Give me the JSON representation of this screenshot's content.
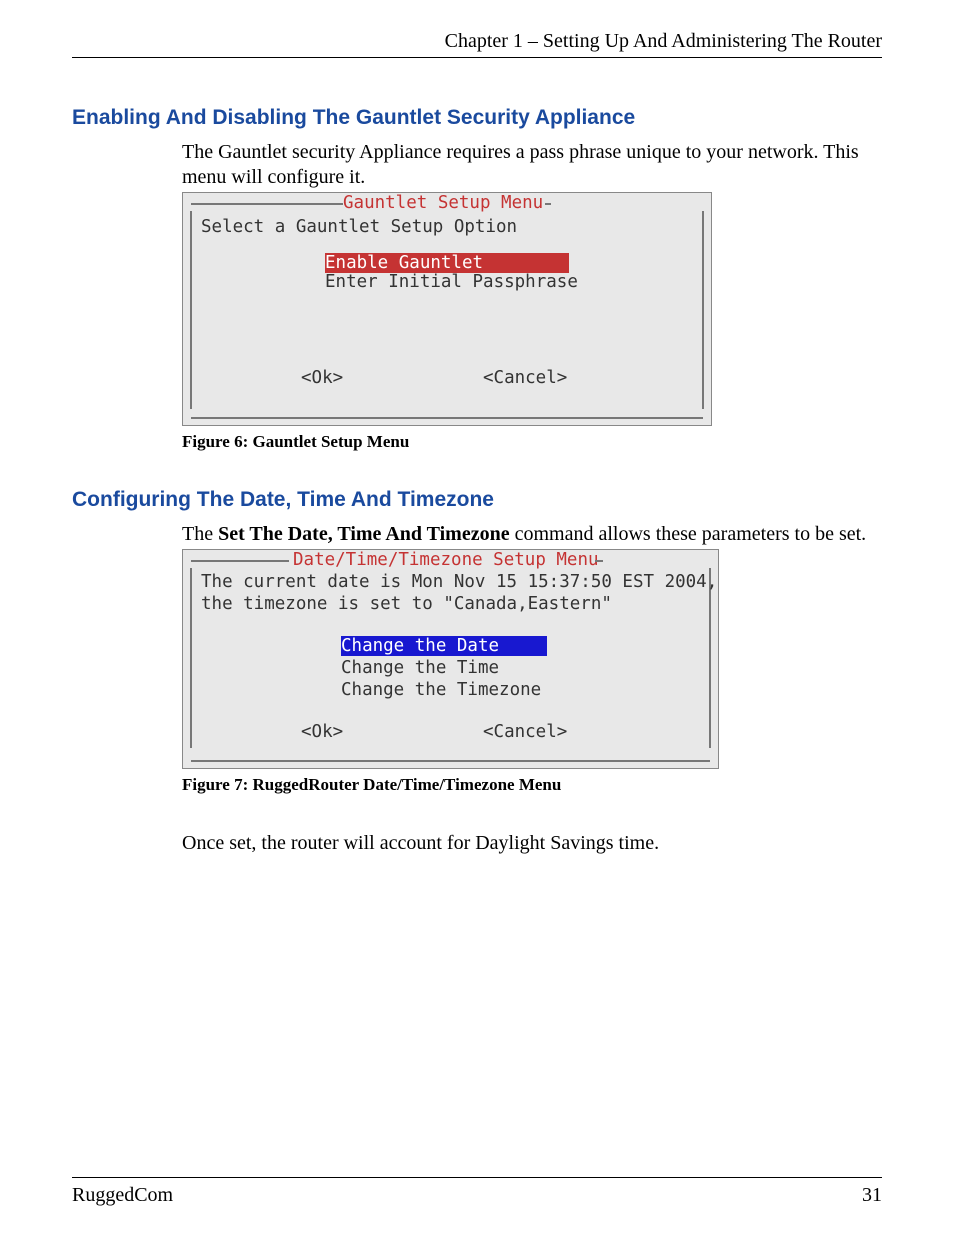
{
  "header": {
    "chapter": "Chapter 1 – Setting Up And Administering The Router"
  },
  "section1": {
    "heading": "Enabling And Disabling The Gauntlet Security Appliance",
    "paragraph": "The Gauntlet security Appliance requires a pass phrase unique to your network.   This menu will configure it."
  },
  "figure6": {
    "title": "Gauntlet Setup Menu",
    "prompt": "Select a Gauntlet Setup Option",
    "option_selected": "Enable Gauntlet        ",
    "option_other": "Enter Initial Passphrase",
    "ok": "<Ok>",
    "cancel": "<Cancel>",
    "caption": "Figure 6: Gauntlet Setup Menu"
  },
  "section2": {
    "heading": "Configuring The Date, Time And Timezone",
    "para_prefix": "The ",
    "para_bold": "Set The Date, Time And Timezone",
    "para_suffix": " command allows these parameters to be set."
  },
  "figure7": {
    "title": "Date/Time/Timezone Setup Menu",
    "line1": "The current date is Mon Nov 15 15:37:50 EST 2004,",
    "line2": "the timezone is set to \"Canada,Eastern\"",
    "option_selected": "Change the Date    ",
    "option2": "Change the Time",
    "option3": "Change the Timezone",
    "ok": "<Ok>",
    "cancel": "<Cancel>",
    "caption": "Figure 7: RuggedRouter Date/Time/Timezone Menu"
  },
  "closing": {
    "text": "Once set, the router will account for Daylight Savings time."
  },
  "footer": {
    "left": "RuggedCom",
    "right": "31"
  }
}
